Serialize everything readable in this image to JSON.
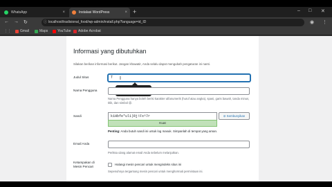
{
  "tabs": [
    {
      "label": "WhatsApp",
      "color": "#25d366"
    },
    {
      "label": "Instalasi WordPress",
      "color": "#f0803c"
    }
  ],
  "address": {
    "url": "localhost/tradisional_food/wp-admin/install.php?language=id_ID"
  },
  "bookmarks": [
    {
      "label": "Gmail",
      "color": "#ea4335"
    },
    {
      "label": "Maps",
      "color": "#34a853"
    },
    {
      "label": "YouTube",
      "color": "#ff0000"
    },
    {
      "label": "Adobe Acrobat",
      "color": "#d7262a"
    }
  ],
  "form": {
    "title": "Informasi yang dibutuhkan",
    "intro": "Silakan berikan informasi berikut. Jangan khawatir, Anda selalu dapat mengubah pengaturan ini nanti.",
    "site_title_label": "Judul Situs",
    "site_title_value": "T",
    "tooltip": "Tradisional Food",
    "username_label": "Nama Pengguna",
    "username_value": "",
    "username_desc": "Nama Pengguna hanya boleh berisi karakter alfanumerik (huruf atau angka), spasi, garis bawah, tanda minus, titik, dan simbol @.",
    "password_label": "Sandi",
    "password_value": "k1Hbfe*ul1)Rj!Fx^7r",
    "password_toggle": "Sembunyikan",
    "strength": "Kuat",
    "note_bold": "Penting:",
    "note_text": " Anda butuh sandi ini untuk log masuk. Simpanlah di tempat yang aman.",
    "email_label": "Email Anda",
    "email_value": "",
    "email_desc": "Periksa ulang alamat email Anda sebelum melanjutkan.",
    "visibility_label": "Ketampakan di Mesin Pencari",
    "visibility_checkbox": "Halangi mesin pencari untuk mengindeks situs ini",
    "visibility_desc": "Sepenuhnya tergantung mesin pencari untuk menghormati permintaan ini."
  }
}
